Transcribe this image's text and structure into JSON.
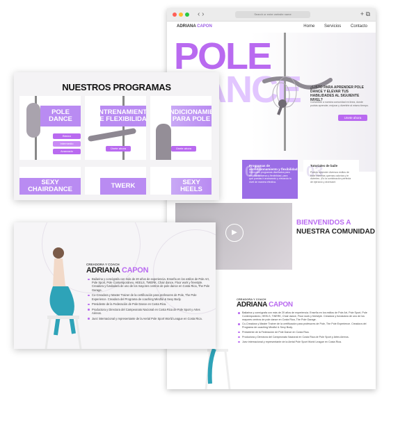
{
  "browser": {
    "url": "Search or enter website name",
    "nav_arrows": "‹ ›",
    "right_icons": "+ ⧉"
  },
  "site": {
    "brand_first": "ADRIANA",
    "brand_last": "CAPON",
    "menu": [
      "Home",
      "Servicios",
      "Contacto"
    ]
  },
  "hero": {
    "line1": "POLE",
    "line2": "DANCE",
    "question": "¿LISTO PARA APRENDER POLE DANCE Y ELEVAR TUS HABILIDADES AL SIGUIENTE NIVEL?",
    "subtext": "Convertirte a nuestra comunidad en línea, donde podrás aprender, mejorar y divertirte al mismo tiempo.",
    "cta": "Unete ahora"
  },
  "features": [
    {
      "num": "02",
      "title": "Programas de acondicionamiento y flexibilidad",
      "text": "Diferentes programas diseñados para mejorar tu fuerza y flexibilidad, para que puedas ir avanzando y elevando tu nivel de manera efectiva."
    },
    {
      "num": "03",
      "title": "Tutoriales de baile",
      "text": "Podrás aprender diversos estilos de baile mientras quemas calorías y te diviertes. ¡Es la combinación perfecta de ejercicio y diversión!"
    }
  ],
  "welcome": {
    "line1": "BIENVENIDOS A",
    "line2": "NUESTRA COMUNIDAD"
  },
  "programs": {
    "title": "NUESTROS PROGRAMAS",
    "items": [
      {
        "title": "POLE DANCE",
        "buttons": [
          "Básico",
          "Intermedio",
          "Avanzado"
        ]
      },
      {
        "title": "ENTRENAMIENTO DE FLEXIBILIDAD",
        "button": "Únete ahora"
      },
      {
        "title": "ACONDICIONAMIENTO PARA POLE",
        "button": "Únete ahora"
      },
      {
        "title": "SEXY CHAIRDANCE"
      },
      {
        "title": "TWERK"
      },
      {
        "title": "SEXY HEELS"
      }
    ]
  },
  "coach": {
    "role": "CREADORA Y COACH",
    "first": "ADRIANA",
    "last": "CAPON",
    "bullets": [
      "Bailarina y coreógrafa con más de 20 años de experiencia. Enseña en los estilos de Pole Art, Pole Sport, Pole Contemporáneo, HEELS, TWERK, Chair dance, Floor work y freestyle. Creadora y fundadora de uno de los mayores centros de pole dance en Costa Rica, The Pole Garage.",
      "Co-Creadora y Master Trainer de la certificación para profesores de Pole, The Pole Experience. Creadora del Programa de coaching Mindful & Sexy Body.",
      "Presidente de la Federación de Pole Dance en Costa Rica.",
      "Productora y Directora del Campeonato Nacional en Costa Rica de Pole Sport y Artes Aéreos.",
      "Juez internacional y representante de la Aerial Pole Sport World League en Costa Rica."
    ]
  },
  "colors": {
    "accent": "#b96af0",
    "accent_light": "#e2c6ff",
    "card_purple": "#9b6ee6"
  }
}
